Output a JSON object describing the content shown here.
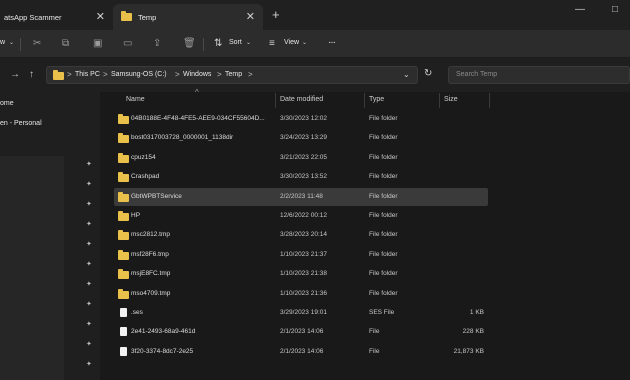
{
  "tabs": [
    {
      "label": "atsApp Scammer",
      "close": "✕"
    },
    {
      "label": "Temp",
      "close": "✕"
    }
  ],
  "new_tab": "+",
  "window_controls": {
    "minimize": "—",
    "maximize": "□"
  },
  "toolbar": {
    "new_label": "w",
    "sort_label": "Sort",
    "view_label": "View",
    "more_label": "···",
    "dropdown": "⌄"
  },
  "address": {
    "crumbs": [
      "This PC",
      "Samsung-OS (C:)",
      "Windows",
      "Temp"
    ],
    "separator": ">",
    "refresh": "↻",
    "search_placeholder": "Search Temp"
  },
  "sidebar": {
    "items": [
      {
        "label": "ome"
      },
      {
        "label": "en - Personal"
      }
    ],
    "pin_glyph": "✦"
  },
  "columns": {
    "name": "Name",
    "date": "Date modified",
    "type": "Type",
    "size": "Size"
  },
  "files": [
    {
      "name": "04B0188E-4F48-4FE5-AEE9-034CF55604D...",
      "date": "3/30/2023 12:02",
      "type": "File folder",
      "size": "",
      "kind": "folder"
    },
    {
      "name": "bost0317003728_0000001_1138dir",
      "date": "3/24/2023 13:29",
      "type": "File folder",
      "size": "",
      "kind": "folder"
    },
    {
      "name": "cpuz154",
      "date": "3/21/2023 22:05",
      "type": "File folder",
      "size": "",
      "kind": "folder"
    },
    {
      "name": "Crashpad",
      "date": "3/30/2023 13:52",
      "type": "File folder",
      "size": "",
      "kind": "folder"
    },
    {
      "name": "GbtWPBTService",
      "date": "2/2/2023 11:48",
      "type": "File folder",
      "size": "",
      "kind": "folder",
      "selected": true
    },
    {
      "name": "HP",
      "date": "12/6/2022 00:12",
      "type": "File folder",
      "size": "",
      "kind": "folder"
    },
    {
      "name": "msc2812.tmp",
      "date": "3/28/2023 20:14",
      "type": "File folder",
      "size": "",
      "kind": "folder"
    },
    {
      "name": "msf28F6.tmp",
      "date": "1/10/2023 21:37",
      "type": "File folder",
      "size": "",
      "kind": "folder"
    },
    {
      "name": "msjE8FC.tmp",
      "date": "1/10/2023 21:38",
      "type": "File folder",
      "size": "",
      "kind": "folder"
    },
    {
      "name": "mso4709.tmp",
      "date": "1/10/2023 21:36",
      "type": "File folder",
      "size": "",
      "kind": "folder"
    },
    {
      "name": ".ses",
      "date": "3/29/2023 19:01",
      "type": "SES File",
      "size": "1 KB",
      "kind": "file"
    },
    {
      "name": "2e41-2493-68a9-461d",
      "date": "2/1/2023 14:06",
      "type": "File",
      "size": "228 KB",
      "kind": "file"
    },
    {
      "name": "3f20-3374-8dc7-2e25",
      "date": "2/1/2023 14:06",
      "type": "File",
      "size": "21,873 KB",
      "kind": "file"
    }
  ],
  "colors": {
    "accent_folder": "#e8c04a",
    "selected_row": "#3a3a3a",
    "background": "#191919"
  }
}
